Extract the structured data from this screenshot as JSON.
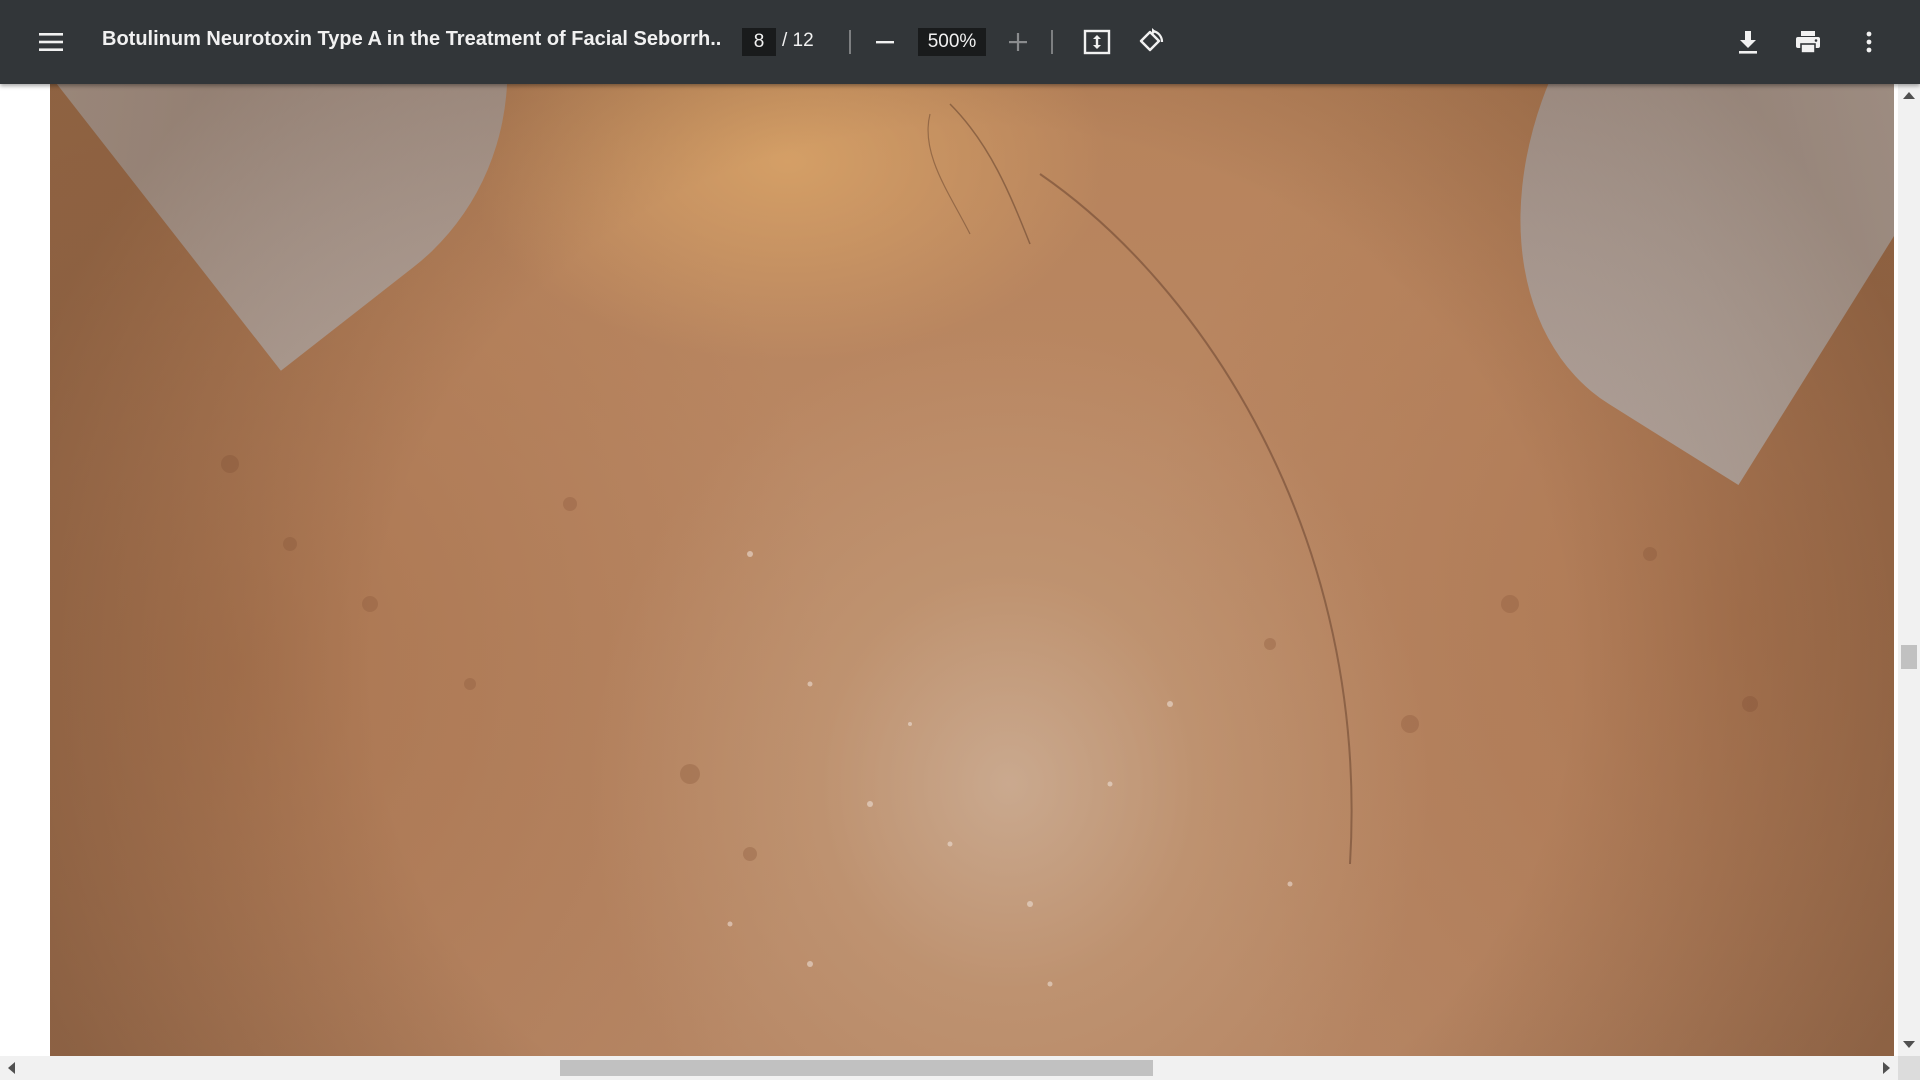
{
  "toolbar": {
    "menu_icon": "hamburger-menu-icon",
    "title": "Botulinum Neurotoxin Type A in the Treatment of Facial Seborrh...",
    "page_current": "8",
    "page_total": "/ 12",
    "zoom_value": "500%",
    "zoom_out_icon": "minus-icon",
    "zoom_in_icon": "plus-icon",
    "fit_page_icon": "fit-to-page-icon",
    "rotate_icon": "rotate-counterclockwise-icon",
    "download_icon": "download-icon",
    "print_icon": "print-icon",
    "more_icon": "more-vertical-icon"
  },
  "document": {
    "image_name": "forehead-skin-photo"
  },
  "scrollbars": {
    "vertical_position": 0.58,
    "vertical_size": 0.026,
    "horizontal_position": 0.29,
    "horizontal_size": 0.32
  },
  "colors": {
    "toolbar_bg": "#323639",
    "toolbar_text": "#f1f1f1",
    "input_bg": "#191b1c"
  }
}
